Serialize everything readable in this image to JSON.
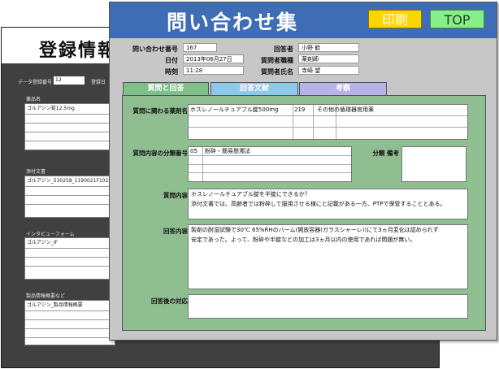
{
  "back_window": {
    "title": "登録情報",
    "reg_label": "データ登録番号",
    "reg_value": "12",
    "reg_label2": "登録日",
    "sections": [
      {
        "label": "薬品名",
        "value": "ゴルアジン錠12.5mg"
      },
      {
        "label": "添付文書",
        "value": "ゴルアジン_530258_1190021F1025_1_02"
      },
      {
        "label": "インタビューフォーム",
        "value": "ゴルアジン_IF"
      },
      {
        "label": "製品情報概要など",
        "value": "ゴルアジン_製品情報概要"
      }
    ]
  },
  "front_window": {
    "title": "問い合わせ集",
    "print_label": "印刷",
    "top_label": "TOP",
    "fields": {
      "inquiry_no_label": "問い合わせ番号",
      "inquiry_no": "167",
      "date_label": "日付",
      "date": "2013年06月27日",
      "time_label": "時刻",
      "time": "11:28",
      "responder_label": "回答者",
      "responder": "小野 歓",
      "occupation_label": "質問者職種",
      "occupation": "薬剤師",
      "asker_name_label": "質問者氏名",
      "asker_name": "寺崎 望"
    },
    "tabs": [
      {
        "label": "質問と回答"
      },
      {
        "label": "回答文献"
      },
      {
        "label": "考察"
      }
    ],
    "panel": {
      "drug_label": "質問に関わる薬剤名",
      "drug_rows": [
        {
          "name": "ホスレノールチュアブル錠500mg",
          "code": "219",
          "category": "その他の循環器官用薬"
        },
        {
          "name": "",
          "code": "",
          "category": ""
        },
        {
          "name": "",
          "code": "",
          "category": ""
        }
      ],
      "class_label": "質問内容の分類番号",
      "class_rows": [
        {
          "code": "05",
          "name": "粉砕・簡易懸濁法"
        },
        {
          "code": "",
          "name": ""
        },
        {
          "code": "",
          "name": ""
        },
        {
          "code": "",
          "name": ""
        }
      ],
      "class_note_label": "分類 備考",
      "question_label": "質問内容",
      "question_lines": [
        "ホスレノールチュアブル錠を半錠にできるか？",
        "添付文書では、高齢者では粉砕して服用させる様にと記載がある一方、PTPで保管することとある。"
      ],
      "answer_label": "回答内容",
      "answer_lines": [
        "製剤の耐湿試験で30℃ 65%RHのバーム(開放容器(ガラスシャーレ))にて3ヵ月変化は認められず",
        "安定であった。よって、粉砕や半錠などの加工は3ヵ月以内の使用であれば問題が無い。"
      ],
      "followup_label": "回答後の対応"
    }
  },
  "colors": {
    "header_blue": "#3f6db5",
    "print_yellow": "#ffd500",
    "top_green": "#88ee88",
    "panel_green": "#8fbf91",
    "tab_blue": "#8ec8ea",
    "tab_purple": "#b7b3ea"
  }
}
